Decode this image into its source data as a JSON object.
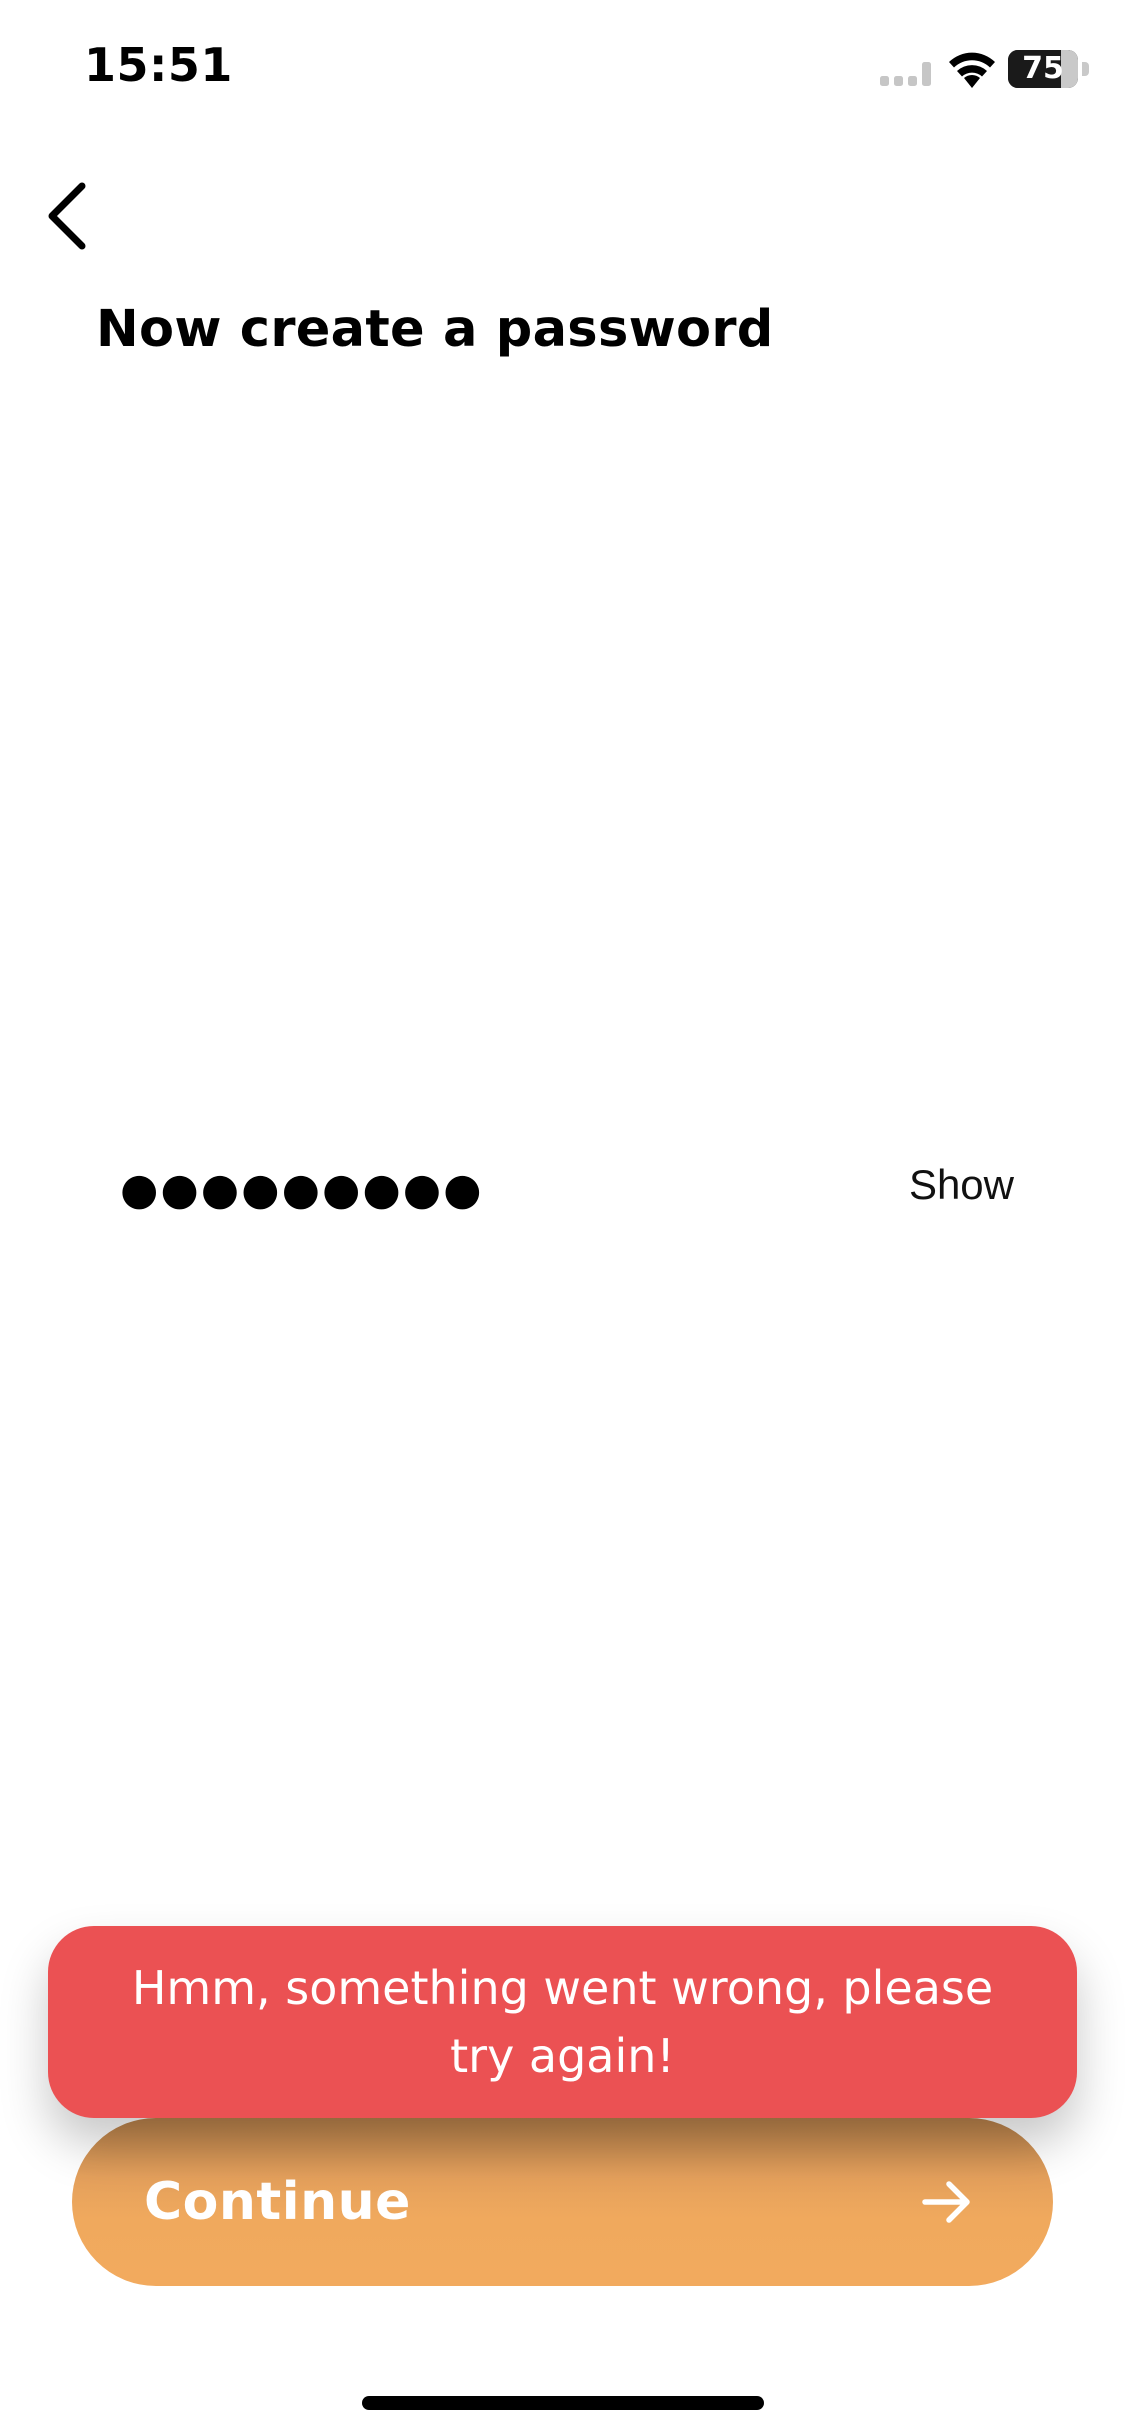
{
  "status_bar": {
    "time": "15:51",
    "battery_level": 75,
    "battery_text": "75"
  },
  "screen": {
    "title": "Now create a password"
  },
  "password_field": {
    "masked_value": "●●●●●●●●●",
    "toggle_label": "Show"
  },
  "error_toast": {
    "message": "Hmm, something went wrong, please try again!"
  },
  "continue_button": {
    "label": "Continue"
  },
  "icons": {
    "back": "chevron-left-icon",
    "continue_arrow": "arrow-right-icon",
    "wifi": "wifi-icon",
    "cellular": "cellular-signal-icon",
    "battery": "battery-icon"
  },
  "colors": {
    "error": "#eb5153",
    "accent": "#f2aa5e",
    "text": "#000000",
    "background": "#ffffff"
  }
}
